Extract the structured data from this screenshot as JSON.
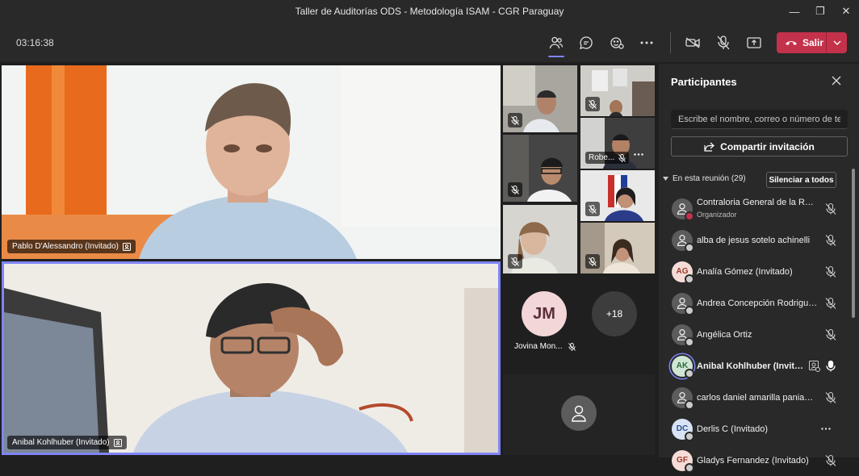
{
  "window": {
    "title": "Taller de Auditorías ODS - Metodología ISAM - CGR Paraguay"
  },
  "toolbar": {
    "timer": "03:16:38",
    "leave_label": "Salir"
  },
  "stage": {
    "main_speaker_1": "Pablo D'Alessandro (Invitado)",
    "main_speaker_2": "Anibal Kohlhuber (Invitado)",
    "thumb_robe": "Robe...",
    "jm_initials": "JM",
    "jm_name": "Jovina Mon...",
    "overflow_count": "+18"
  },
  "panel": {
    "title": "Participantes",
    "search_placeholder": "Escribe el nombre, correo o número de te",
    "share_label": "Compartir invitación",
    "section_label": "En esta reunión (29)",
    "mute_all_label": "Silenciar a todos",
    "participants": [
      {
        "name": "Contraloria General de la Rep...",
        "role": "Organizador",
        "initials": ""
      },
      {
        "name": "alba de jesus sotelo achinelli",
        "initials": ""
      },
      {
        "name": "Analía Gómez (Invitado)",
        "initials": "AG"
      },
      {
        "name": "Andrea Concepción Rodrigue...",
        "initials": ""
      },
      {
        "name": "Angélica Ortiz",
        "initials": ""
      },
      {
        "name": "Anibal Kohlhuber (Invita...",
        "initials": "AK"
      },
      {
        "name": "carlos daniel amarilla paniagua",
        "initials": ""
      },
      {
        "name": "Derlis C (Invitado)",
        "initials": "DC"
      },
      {
        "name": "Gladys Fernandez (Invitado)",
        "initials": "GF"
      }
    ]
  }
}
